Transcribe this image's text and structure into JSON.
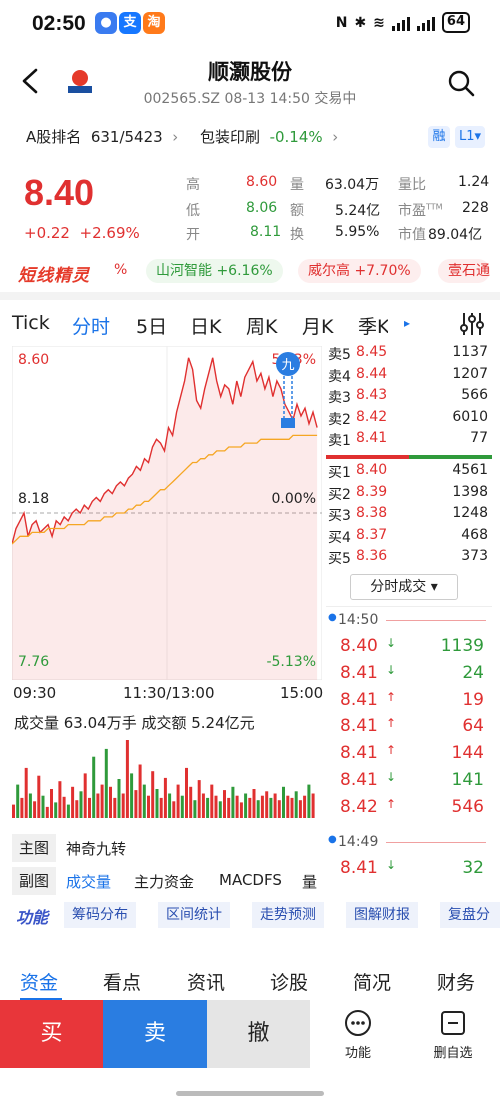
{
  "status": {
    "time": "02:50",
    "battery": "64"
  },
  "header": {
    "title": "顺灏股份",
    "code": "002565.SZ",
    "datetime": "08-13 14:50",
    "state": "交易中"
  },
  "rank": {
    "label": "A股排名",
    "value": "631/5423",
    "sector": "包装印刷",
    "sector_change": "-0.14%",
    "badge_margin": "融",
    "badge_level": "L1"
  },
  "quote": {
    "price": "8.40",
    "change": "+0.22",
    "change_pct": "+2.69%",
    "high_label": "高",
    "high": "8.60",
    "low_label": "低",
    "low": "8.06",
    "open_label": "开",
    "open": "8.11",
    "volume_label": "量",
    "volume": "63.04万",
    "amount_label": "额",
    "amount": "5.24亿",
    "turnover_label": "换",
    "turnover": "5.95%",
    "vol_ratio_label": "量比",
    "vol_ratio": "1.24",
    "pe_label": "市盈",
    "pe_sup": "TTM",
    "pe": "228",
    "mcap_label": "市值",
    "mcap": "89.04亿"
  },
  "banner": {
    "logo": "短线精灵",
    "pct_label": "%",
    "chips": [
      {
        "name": "山河智能",
        "pct": "+6.16%"
      },
      {
        "name": "威尔高",
        "pct": "+7.70%"
      },
      {
        "name": "壹石通",
        "pct": ""
      }
    ]
  },
  "tabs": [
    "Tick",
    "分时",
    "5日",
    "日K",
    "周K",
    "月K",
    "季K"
  ],
  "active_tab": "分时",
  "chart_axis": {
    "top_price": "8.60",
    "mid_price": "8.18",
    "bottom_price": "7.76",
    "top_pct": "5.13%",
    "mid_pct": "0.00%",
    "bottom_pct": "-5.13%",
    "time_start": "09:30",
    "time_mid": "11:30/13:00",
    "time_end": "15:00"
  },
  "chart_data": {
    "type": "line",
    "title": "",
    "xlabel": "",
    "ylabel": "",
    "ylim": [
      7.76,
      8.6
    ],
    "prev_close": 8.18,
    "series": [
      {
        "values": [
          8.1,
          8.14,
          8.16,
          8.18,
          8.12,
          8.15,
          8.16,
          8.13,
          8.14,
          8.15,
          8.12,
          8.16,
          8.15,
          8.17,
          8.16,
          8.18,
          8.19,
          8.18,
          8.2,
          8.19,
          8.21,
          8.22,
          8.21,
          8.23,
          8.24,
          8.23,
          8.25,
          8.26,
          8.25,
          8.27,
          8.28,
          8.3,
          8.29,
          8.32,
          8.31,
          8.35,
          8.37,
          8.36,
          8.34,
          8.4,
          8.38,
          8.44,
          8.48,
          8.52,
          8.58,
          8.55,
          8.47,
          8.45,
          8.5,
          8.54,
          8.58,
          8.52,
          8.48,
          8.51,
          8.5,
          8.46,
          8.52,
          8.48,
          8.53,
          8.55,
          8.57,
          8.52,
          8.54,
          8.5,
          8.53,
          8.48,
          8.52,
          8.5,
          8.46,
          8.44,
          8.42,
          8.46,
          8.43,
          8.45,
          8.41,
          8.44,
          8.4
        ]
      },
      {
        "values": [
          8.1,
          8.11,
          8.12,
          8.12,
          8.12,
          8.13,
          8.13,
          8.13,
          8.13,
          8.14,
          8.14,
          8.14,
          8.14,
          8.14,
          8.15,
          8.15,
          8.15,
          8.15,
          8.15,
          8.16,
          8.16,
          8.16,
          8.16,
          8.17,
          8.17,
          8.17,
          8.18,
          8.18,
          8.18,
          8.19,
          8.19,
          8.2,
          8.2,
          8.21,
          8.21,
          8.22,
          8.23,
          8.24,
          8.24,
          8.25,
          8.26,
          8.27,
          8.28,
          8.29,
          8.3,
          8.31,
          8.31,
          8.32,
          8.32,
          8.33,
          8.33,
          8.34,
          8.34,
          8.34,
          8.35,
          8.35,
          8.35,
          8.35,
          8.36,
          8.36,
          8.36,
          8.36,
          8.37,
          8.37,
          8.37,
          8.37,
          8.37,
          8.37,
          8.37,
          8.37,
          8.38,
          8.38,
          8.38,
          8.38,
          8.38,
          8.38,
          8.38
        ]
      }
    ],
    "volume": [
      12,
      30,
      18,
      45,
      22,
      15,
      38,
      20,
      10,
      26,
      14,
      33,
      19,
      12,
      28,
      16,
      24,
      40,
      18,
      55,
      22,
      30,
      62,
      28,
      18,
      35,
      22,
      70,
      40,
      25,
      48,
      30,
      20,
      42,
      26,
      18,
      36,
      22,
      15,
      30,
      20,
      45,
      28,
      16,
      34,
      22,
      18,
      30,
      20,
      15,
      25,
      18,
      28,
      20,
      14,
      22,
      18,
      26,
      16,
      20,
      24,
      18,
      22,
      16,
      28,
      20,
      18,
      24,
      16,
      20,
      30,
      22
    ]
  },
  "order_book": {
    "asks": [
      {
        "label": "卖5",
        "price": "8.45",
        "vol": "1137"
      },
      {
        "label": "卖4",
        "price": "8.44",
        "vol": "1207"
      },
      {
        "label": "卖3",
        "price": "8.43",
        "vol": "566"
      },
      {
        "label": "卖2",
        "price": "8.42",
        "vol": "6010"
      },
      {
        "label": "卖1",
        "price": "8.41",
        "vol": "77"
      }
    ],
    "bids": [
      {
        "label": "买1",
        "price": "8.40",
        "vol": "4561"
      },
      {
        "label": "买2",
        "price": "8.39",
        "vol": "1398"
      },
      {
        "label": "买3",
        "price": "8.38",
        "vol": "1248"
      },
      {
        "label": "买4",
        "price": "8.37",
        "vol": "468"
      },
      {
        "label": "买5",
        "price": "8.36",
        "vol": "373"
      }
    ],
    "dropdown": "分时成交"
  },
  "volume_info": {
    "text": "成交量 63.04万手  成交额 5.24亿元"
  },
  "ticks": {
    "time1": "14:50",
    "rows1": [
      {
        "price": "8.40",
        "dir": "down",
        "vol": "1139"
      },
      {
        "price": "8.41",
        "dir": "down",
        "vol": "24"
      },
      {
        "price": "8.41",
        "dir": "up",
        "vol": "19"
      },
      {
        "price": "8.41",
        "dir": "up",
        "vol": "64"
      },
      {
        "price": "8.41",
        "dir": "up",
        "vol": "144"
      },
      {
        "price": "8.41",
        "dir": "down",
        "vol": "141"
      },
      {
        "price": "8.42",
        "dir": "up",
        "vol": "546"
      }
    ],
    "time2": "14:49",
    "rows2": [
      {
        "price": "8.41",
        "dir": "down",
        "vol": "32"
      }
    ]
  },
  "indicators": {
    "main_key": "主图",
    "main_value": "神奇九转",
    "sub_key": "副图",
    "sub_items": [
      "成交量",
      "主力资金",
      "MACDFS",
      "量"
    ]
  },
  "functions": {
    "logo": "功能",
    "items": [
      "筹码分布",
      "区间统计",
      "走势预测",
      "图解财报",
      "复盘分"
    ]
  },
  "bottom_tabs": [
    "资金",
    "看点",
    "资讯",
    "诊股",
    "简况",
    "财务"
  ],
  "active_bottom_tab": "资金",
  "actions": {
    "buy": "买",
    "sell": "卖",
    "cancel": "撤",
    "func": "功能",
    "delete": "删自选"
  },
  "colors": {
    "up": "#e03030",
    "down": "#2f9a3b",
    "accent": "#1a73e8",
    "avg_line": "#f5a623"
  }
}
